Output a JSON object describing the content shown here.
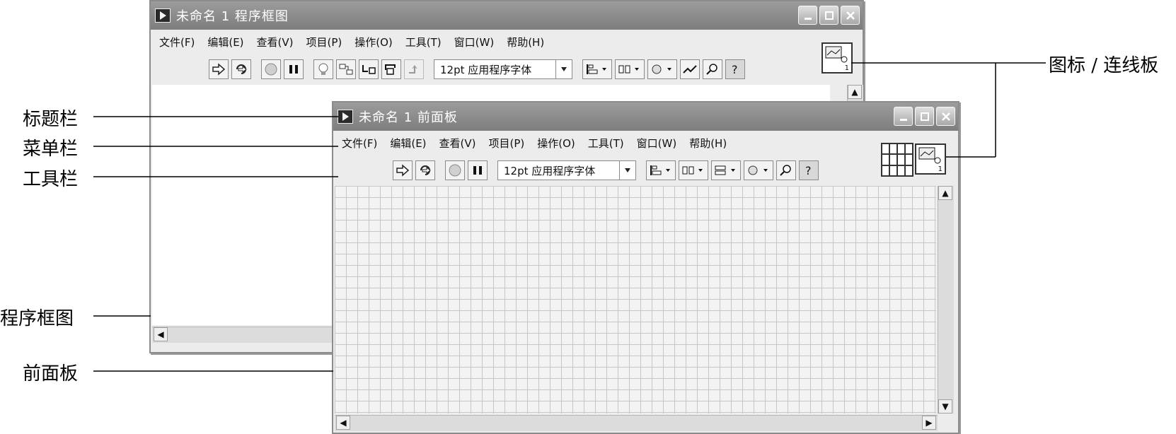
{
  "block_diagram": {
    "title": "未命名 1 程序框图",
    "menu": [
      "文件(F)",
      "编辑(E)",
      "查看(V)",
      "项目(P)",
      "操作(O)",
      "工具(T)",
      "窗口(W)",
      "帮助(H)"
    ],
    "font": "12pt 应用程序字体",
    "icon_number": "1"
  },
  "front_panel": {
    "title": "未命名 1 前面板",
    "menu": [
      "文件(F)",
      "编辑(E)",
      "查看(V)",
      "项目(P)",
      "操作(O)",
      "工具(T)",
      "窗口(W)",
      "帮助(H)"
    ],
    "font": "12pt 应用程序字体",
    "icon_number": "1"
  },
  "labels": {
    "title_bar": "标题栏",
    "menu_bar": "菜单栏",
    "toolbar": "工具栏",
    "block_diagram": "程序框图",
    "front_panel": "前面板",
    "icon_connector": "图标 / 连线板"
  },
  "icons": {
    "run": "run-arrow-icon",
    "run_continuous": "run-continuously-icon",
    "abort": "abort-icon",
    "pause": "pause-icon",
    "highlight": "lightbulb-icon",
    "retain": "retain-wire-values-icon",
    "step_into": "step-into-icon",
    "step_over": "step-over-icon",
    "step_out": "step-out-icon",
    "align": "align-objects-icon",
    "distribute": "distribute-objects-icon",
    "resize": "resize-objects-icon",
    "reorder": "reorder-icon",
    "cleanup": "clean-up-diagram-icon",
    "search": "search-icon",
    "help": "context-help-icon"
  }
}
